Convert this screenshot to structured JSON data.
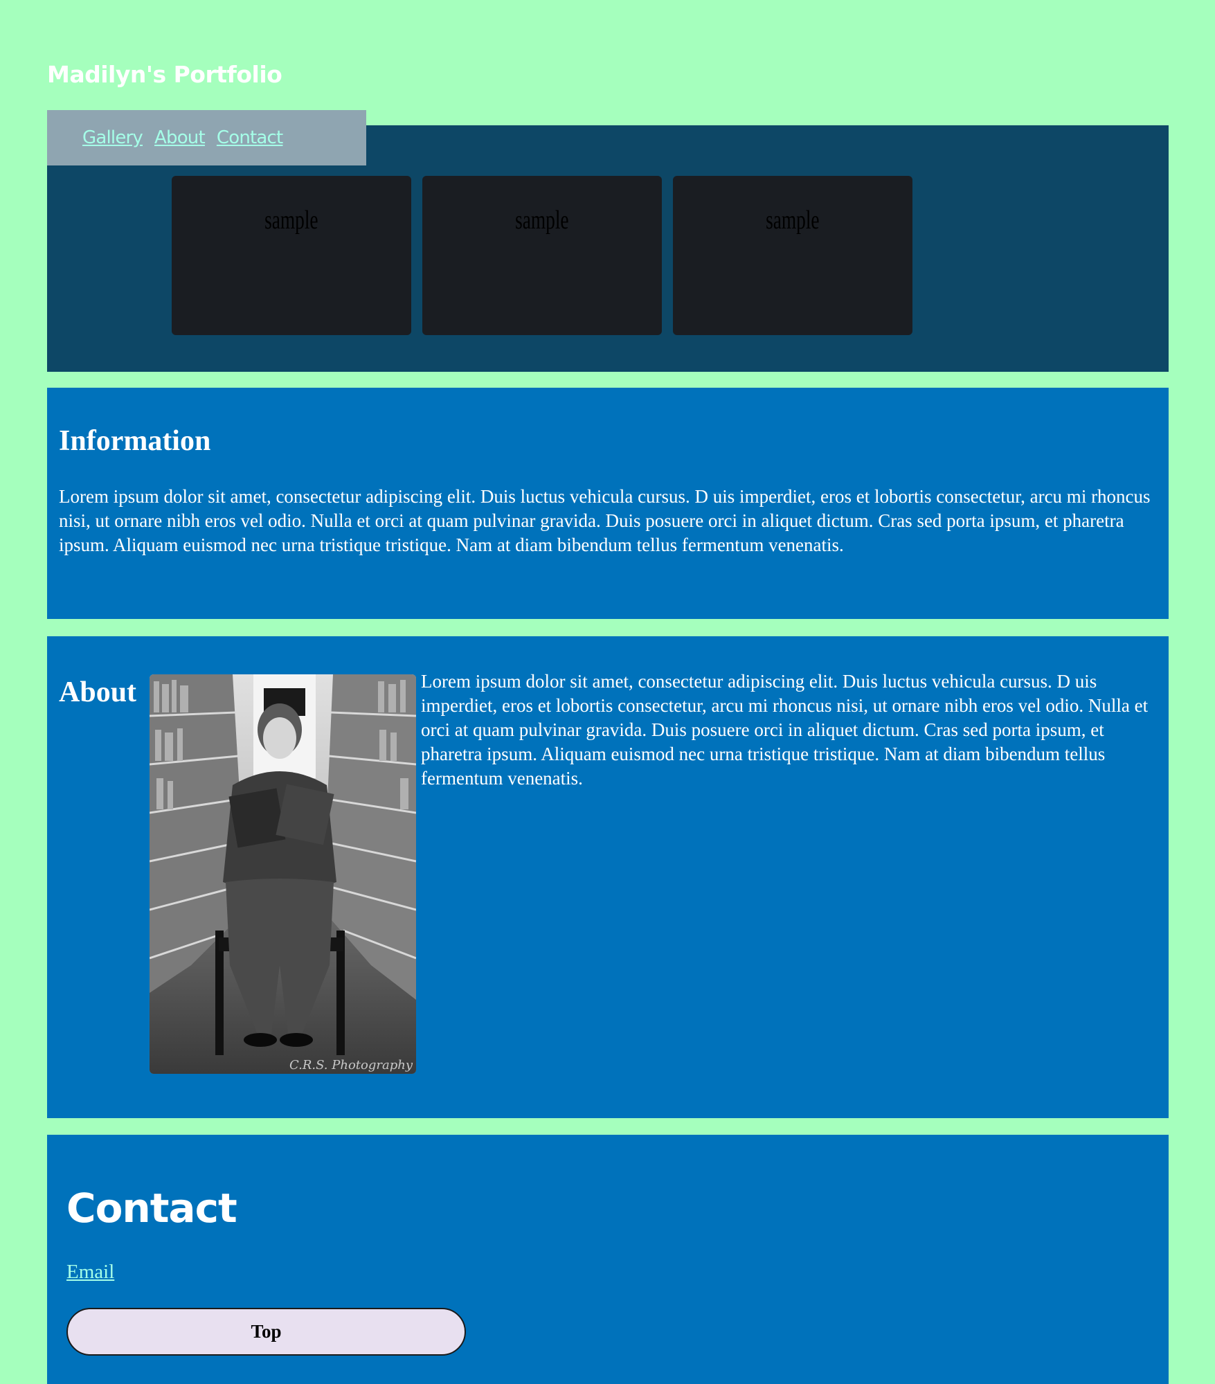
{
  "site": {
    "title": "Madilyn's Portfolio"
  },
  "nav": {
    "items": [
      {
        "label": "Gallery"
      },
      {
        "label": "About"
      },
      {
        "label": "Contact"
      }
    ]
  },
  "gallery": {
    "items": [
      {
        "label": "sample"
      },
      {
        "label": "sample"
      },
      {
        "label": "sample"
      }
    ]
  },
  "information": {
    "heading": "Information",
    "body": "Lorem ipsum dolor sit amet, consectetur adipiscing elit. Duis luctus vehicula cursus. D uis imperdiet, eros et lobortis consectetur, arcu mi rhoncus nisi, ut ornare nibh eros vel odio. Nulla et orci at quam pulvinar gravida. Duis posuere orci in aliquet dictum. Cras sed porta ipsum, et pharetra ipsum. Aliquam euismod nec urna tristique tristique. Nam at diam bibendum tellus fermentum venenatis."
  },
  "about": {
    "heading": "About",
    "body": "Lorem ipsum dolor sit amet, consectetur adipiscing elit. Duis luctus vehicula cursus. D uis imperdiet, eros et lobortis consectetur, arcu mi rhoncus nisi, ut ornare nibh eros vel odio. Nulla et orci at quam pulvinar gravida. Duis posuere orci in aliquet dictum. Cras sed porta ipsum, et pharetra ipsum. Aliquam euismod nec urna tristique tristique. Nam at diam bibendum tellus fermentum venenatis.",
    "photo_watermark": "C.R.S. Photography"
  },
  "contact": {
    "heading": "Contact",
    "email_label": "Email",
    "top_button_label": "Top"
  },
  "colors": {
    "page_background": "#a5ffbd",
    "gallery_background": "#0d4766",
    "nav_background": "#8fa5b1",
    "section_background": "#0072bb",
    "link": "#a5ffe8",
    "button_background": "#e8e0f0"
  }
}
